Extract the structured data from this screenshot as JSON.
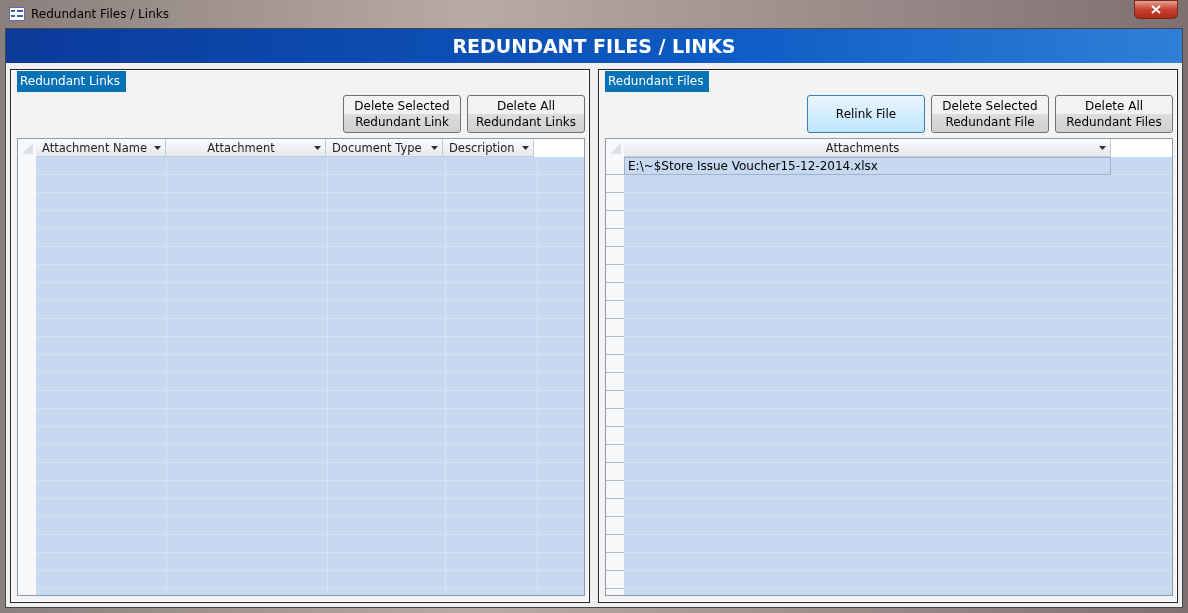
{
  "window": {
    "title": "Redundant Files / Links"
  },
  "header": {
    "title": "REDUNDANT FILES / LINKS"
  },
  "panels": [
    {
      "title": "Redundant Links",
      "buttons": [
        {
          "label": "Delete Selected Redundant Link",
          "highlighted": false
        },
        {
          "label": "Delete All Redundant Links",
          "highlighted": false
        }
      ],
      "columns": [
        {
          "label": "Attachment Name"
        },
        {
          "label": "Attachment"
        },
        {
          "label": "Document Type"
        },
        {
          "label": "Description"
        }
      ]
    },
    {
      "title": "Redundant Files",
      "buttons": [
        {
          "label": "Relink File",
          "highlighted": true
        },
        {
          "label": "Delete Selected Redundant File",
          "highlighted": false
        },
        {
          "label": "Delete All Redundant Files",
          "highlighted": false
        }
      ],
      "columns": [
        {
          "label": "Attachments"
        }
      ],
      "rows": [
        [
          "E:\\~$Store Issue Voucher15-12-2014.xlsx"
        ]
      ]
    }
  ]
}
